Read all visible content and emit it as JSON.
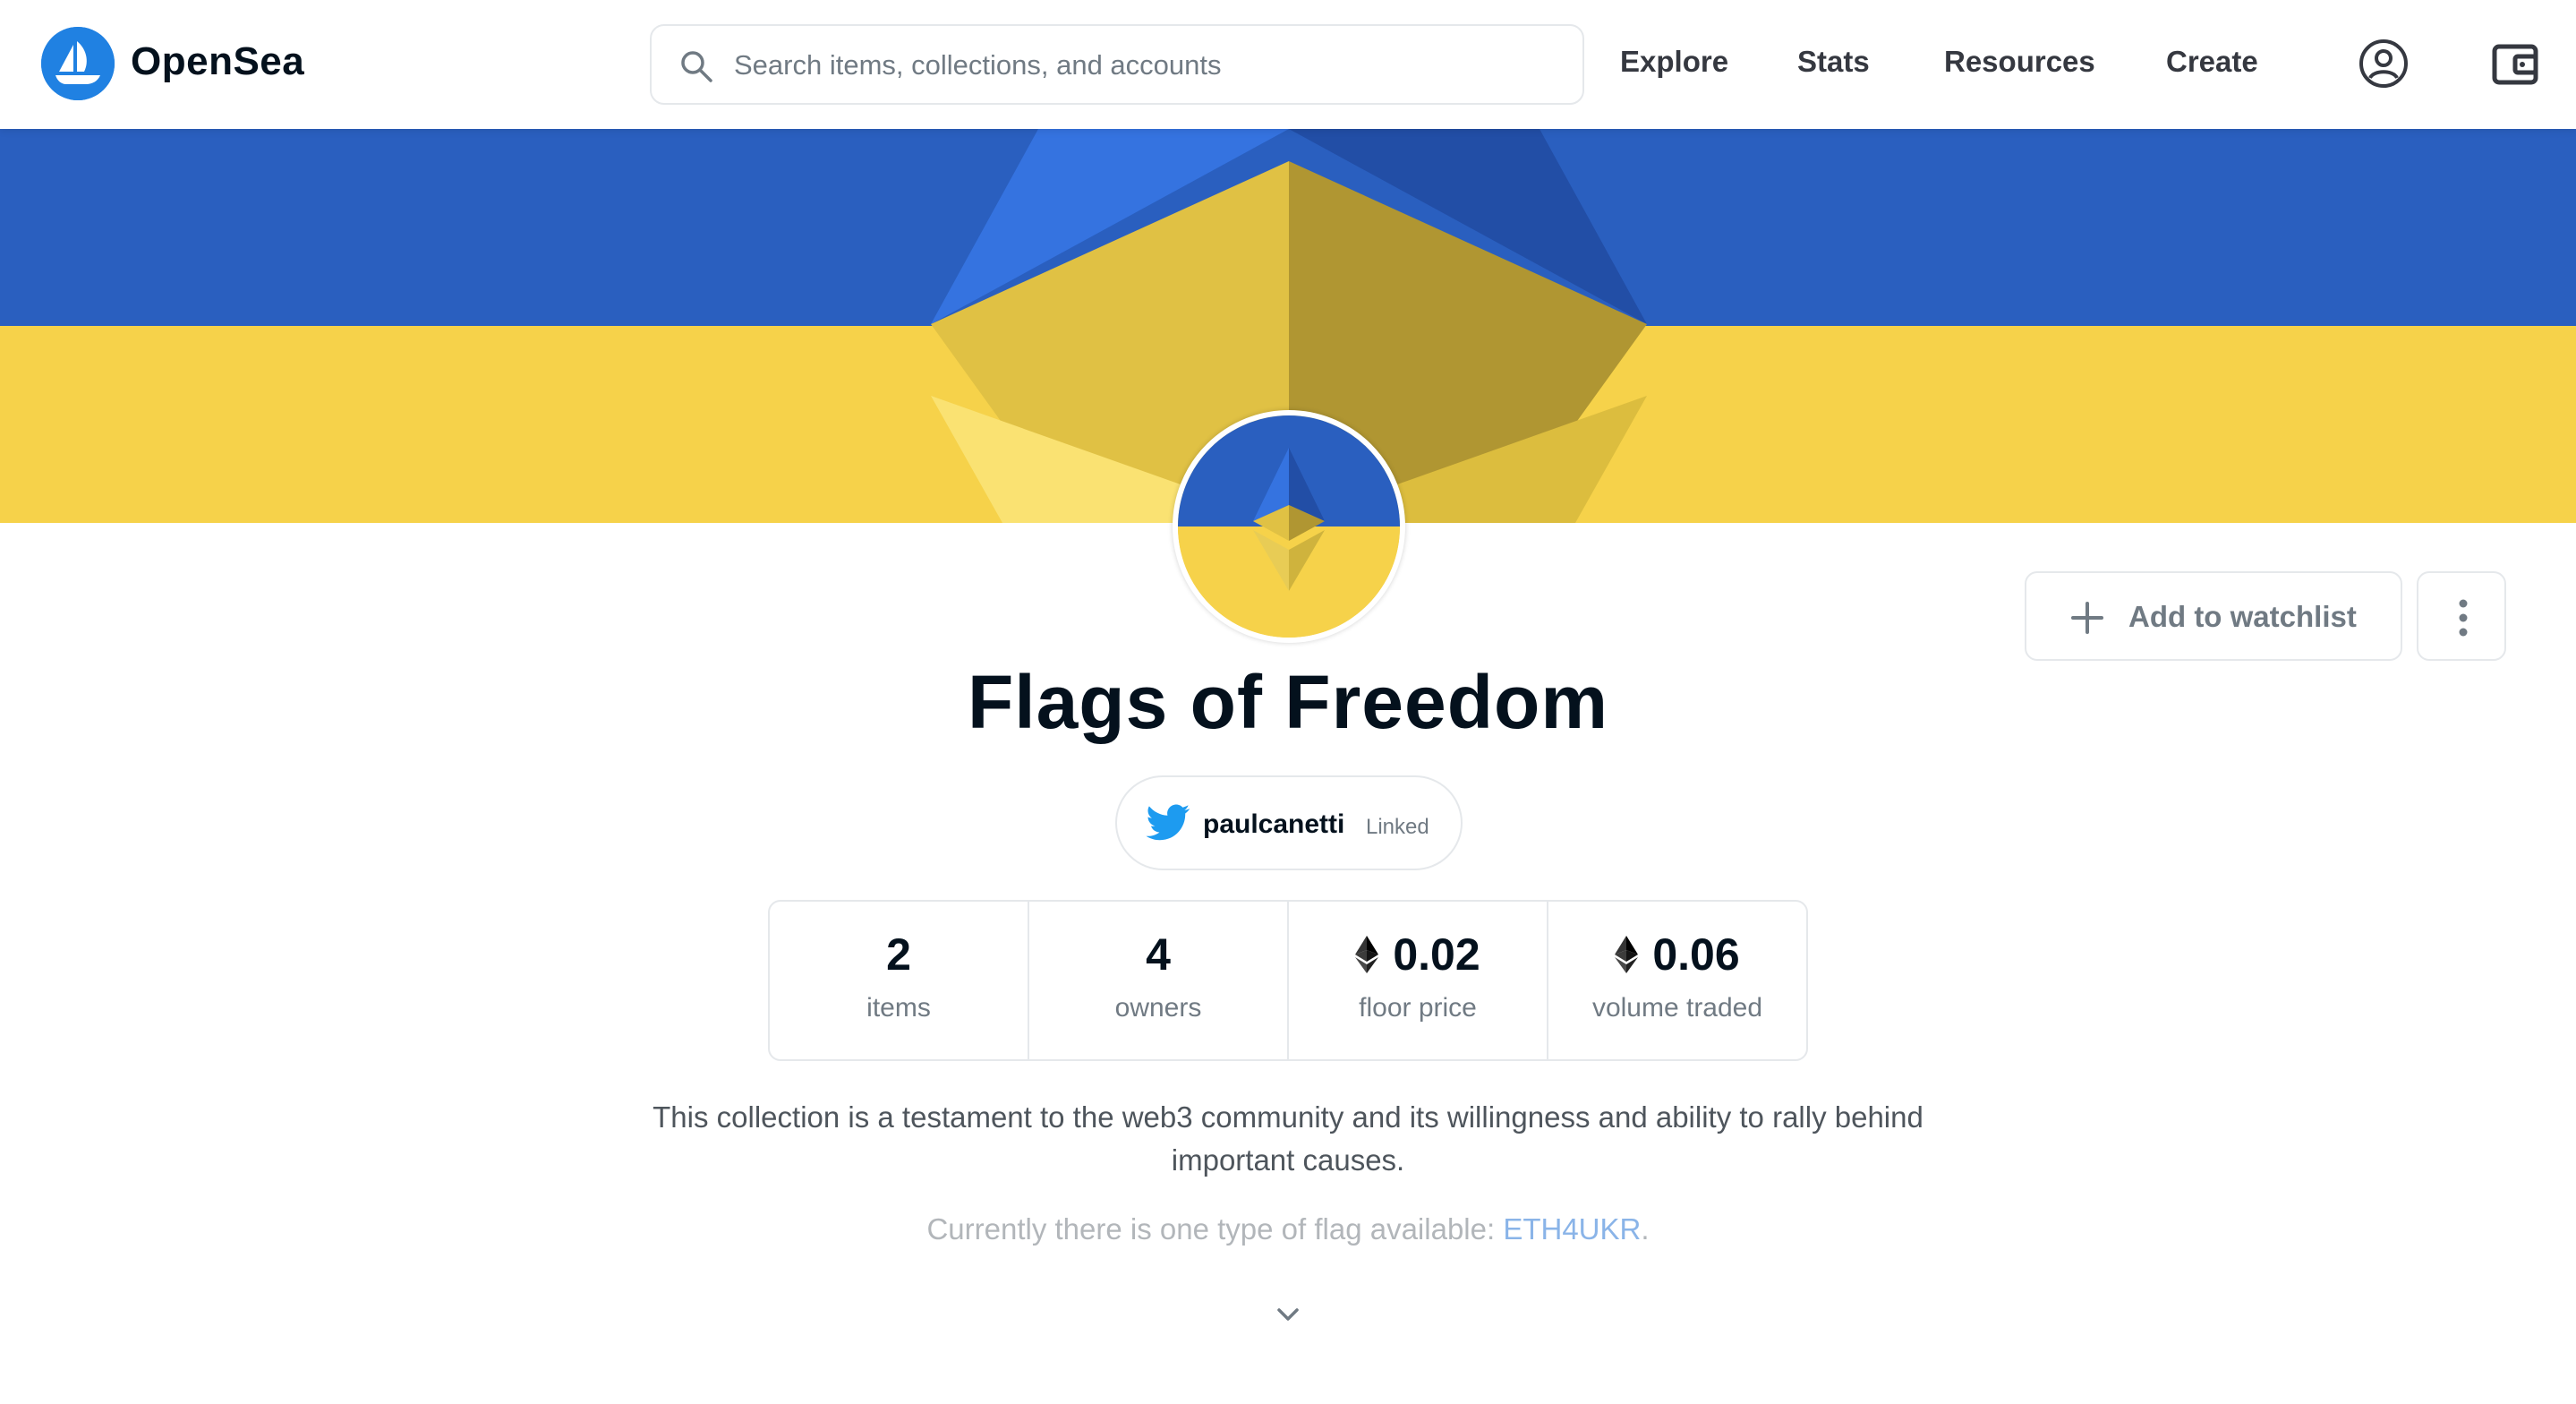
{
  "header": {
    "brand": "OpenSea",
    "search_placeholder": "Search items, collections, and accounts",
    "nav": {
      "explore": "Explore",
      "stats": "Stats",
      "resources": "Resources",
      "create": "Create"
    },
    "icons": [
      "opensea-logo-icon",
      "search-icon",
      "account-icon",
      "wallet-icon"
    ]
  },
  "actions": {
    "watchlist_label": "Add to watchlist"
  },
  "collection": {
    "title": "Flags of Freedom",
    "twitter": {
      "handle": "paulcanetti",
      "status": "Linked"
    },
    "stats": [
      {
        "value": "2",
        "label": "items",
        "eth": false
      },
      {
        "value": "4",
        "label": "owners",
        "eth": false
      },
      {
        "value": "0.02",
        "label": "floor price",
        "eth": true
      },
      {
        "value": "0.06",
        "label": "volume traded",
        "eth": true
      }
    ],
    "description": "This collection is a testament to the web3 community and its willingness and ability to rally behind important causes.",
    "sub_description_prefix": "Currently there is one type of flag available: ",
    "sub_description_link": "ETH4UKR",
    "sub_description_suffix": "."
  },
  "colors": {
    "flag_blue": "#2a5fbf",
    "flag_yellow": "#f6d24a",
    "brand_blue": "#2081e2",
    "link": "#8ab4e8"
  }
}
